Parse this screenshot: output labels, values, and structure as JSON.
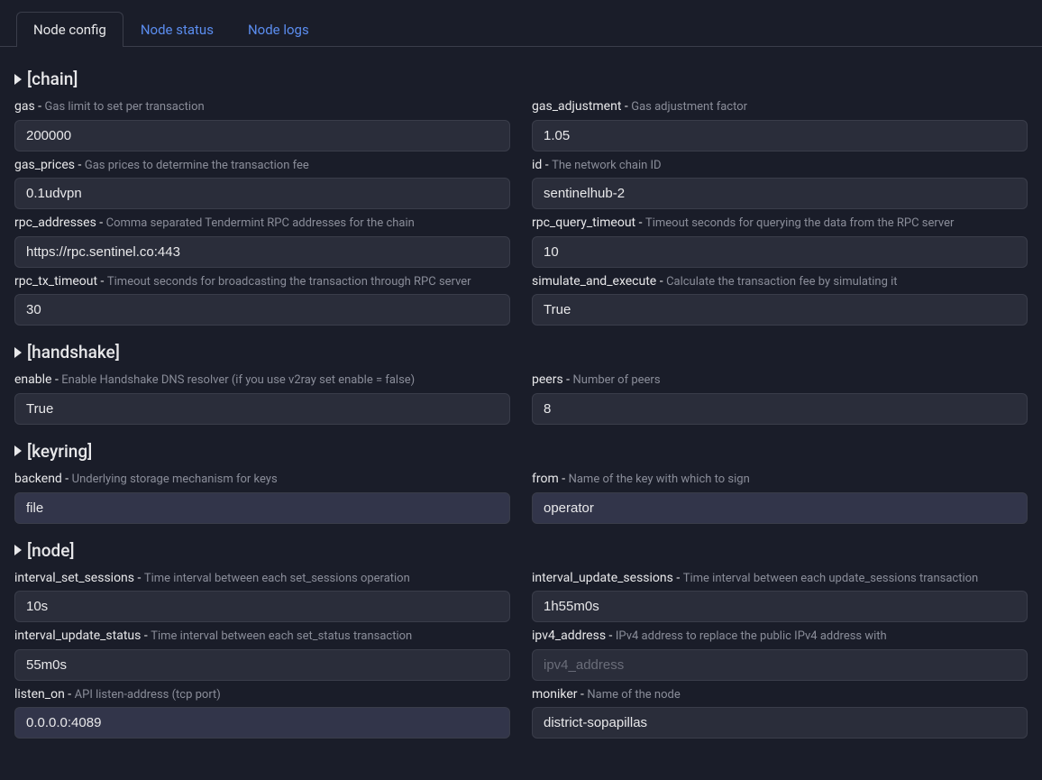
{
  "tabs": {
    "config": "Node config",
    "status": "Node status",
    "logs": "Node logs"
  },
  "sections": {
    "chain": {
      "title": "[chain]",
      "gas": {
        "name": "gas",
        "desc": "Gas limit to set per transaction",
        "value": "200000"
      },
      "gas_adjustment": {
        "name": "gas_adjustment",
        "desc": "Gas adjustment factor",
        "value": "1.05"
      },
      "gas_prices": {
        "name": "gas_prices",
        "desc": "Gas prices to determine the transaction fee",
        "value": "0.1udvpn"
      },
      "id": {
        "name": "id",
        "desc": "The network chain ID",
        "value": "sentinelhub-2"
      },
      "rpc_addresses": {
        "name": "rpc_addresses",
        "desc": "Comma separated Tendermint RPC addresses for the chain",
        "value": "https://rpc.sentinel.co:443"
      },
      "rpc_query_timeout": {
        "name": "rpc_query_timeout",
        "desc": "Timeout seconds for querying the data from the RPC server",
        "value": "10"
      },
      "rpc_tx_timeout": {
        "name": "rpc_tx_timeout",
        "desc": "Timeout seconds for broadcasting the transaction through RPC server",
        "value": "30"
      },
      "simulate_and_execute": {
        "name": "simulate_and_execute",
        "desc": "Calculate the transaction fee by simulating it",
        "value": "True"
      }
    },
    "handshake": {
      "title": "[handshake]",
      "enable": {
        "name": "enable",
        "desc": "Enable Handshake DNS resolver (if you use v2ray set enable = false)",
        "value": "True"
      },
      "peers": {
        "name": "peers",
        "desc": "Number of peers",
        "value": "8"
      }
    },
    "keyring": {
      "title": "[keyring]",
      "backend": {
        "name": "backend",
        "desc": "Underlying storage mechanism for keys",
        "value": "file"
      },
      "from": {
        "name": "from",
        "desc": "Name of the key with which to sign",
        "value": "operator"
      }
    },
    "node": {
      "title": "[node]",
      "interval_set_sessions": {
        "name": "interval_set_sessions",
        "desc": "Time interval between each set_sessions operation",
        "value": "10s"
      },
      "interval_update_sessions": {
        "name": "interval_update_sessions",
        "desc": "Time interval between each update_sessions transaction",
        "value": "1h55m0s"
      },
      "interval_update_status": {
        "name": "interval_update_status",
        "desc": "Time interval between each set_status transaction",
        "value": "55m0s"
      },
      "ipv4_address": {
        "name": "ipv4_address",
        "desc": "IPv4 address to replace the public IPv4 address with",
        "value": "",
        "placeholder": "ipv4_address"
      },
      "listen_on": {
        "name": "listen_on",
        "desc": "API listen-address (tcp port)",
        "value": "0.0.0.0:4089"
      },
      "moniker": {
        "name": "moniker",
        "desc": "Name of the node",
        "value": "district-sopapillas"
      }
    }
  }
}
